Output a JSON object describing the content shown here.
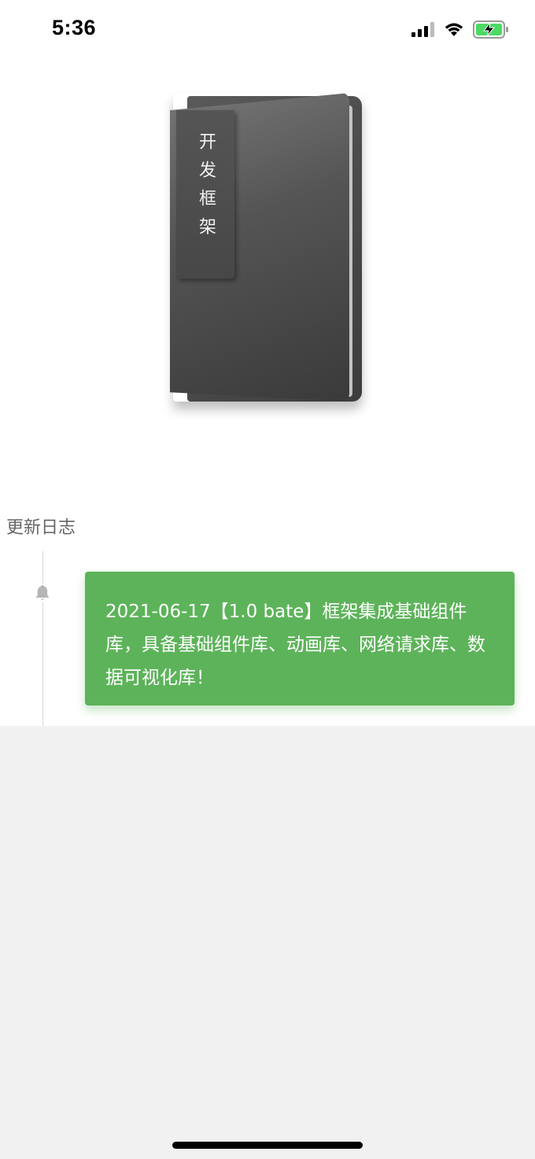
{
  "status_bar": {
    "time": "5:36",
    "icons": [
      "signal-icon",
      "wifi-icon",
      "battery-charging-icon"
    ]
  },
  "cover": {
    "title": "开发框架"
  },
  "changelog": {
    "title": "更新日志",
    "entries": [
      {
        "icon": "bell-icon",
        "text": "2021-06-17【1.0 bate】框架集成基础组件库，具备基础组件库、动画库、网络请求库、数据可视化库！"
      }
    ]
  },
  "colors": {
    "card_green": "#5db35a",
    "background": "#f1f1f1",
    "battery_green": "#4cd964"
  }
}
